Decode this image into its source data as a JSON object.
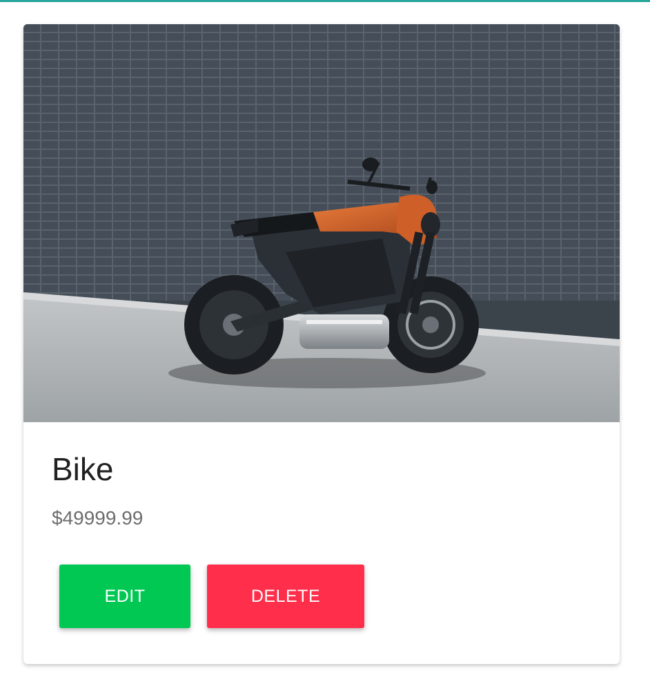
{
  "product": {
    "title": "Bike",
    "price": "$49999.99",
    "image": {
      "subject": "motorcycle-photo",
      "colors": {
        "wall": "#3b434b",
        "ground": "#a9adb0",
        "body": "#2b3036",
        "accent": "#d8642a"
      }
    }
  },
  "actions": {
    "edit_label": "EDIT",
    "delete_label": "DELETE"
  },
  "theme": {
    "accent_bar": "#26a69a",
    "edit_color": "#00c853",
    "delete_color": "#ff2e4a"
  }
}
